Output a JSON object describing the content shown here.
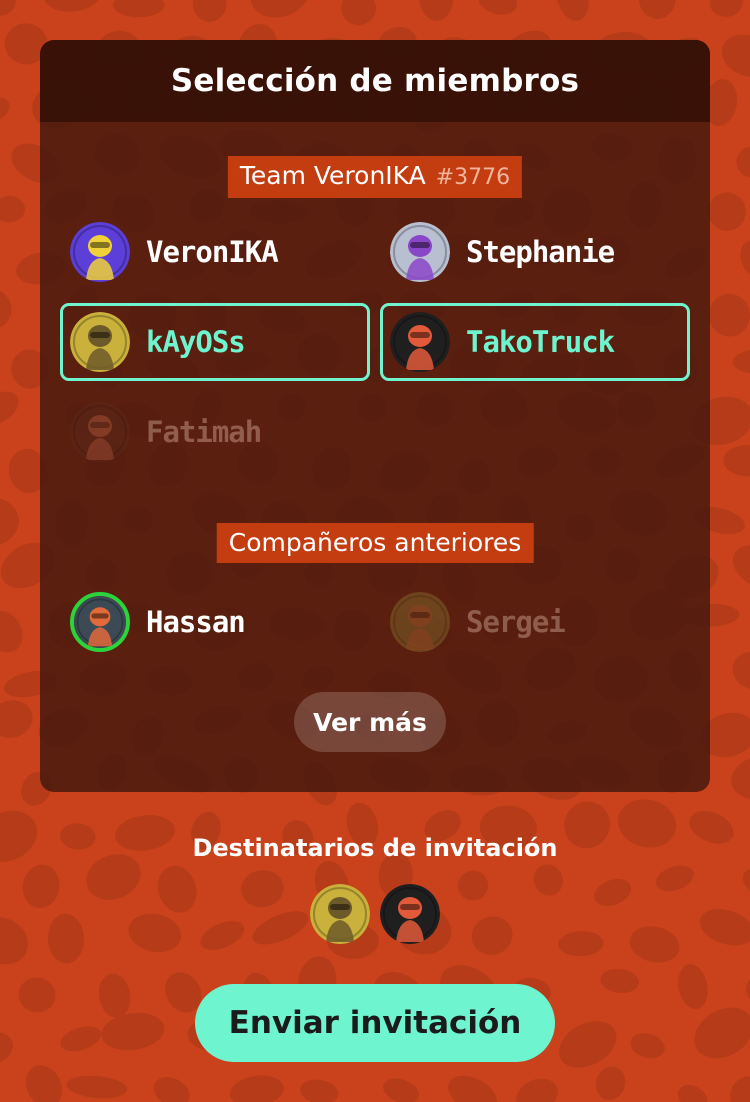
{
  "panel": {
    "title": "Selección de miembros"
  },
  "team": {
    "name": "Team VeronIKA",
    "tag": "#3776",
    "members": [
      {
        "name": "VeronIKA",
        "state": "normal",
        "avatar_bg": "#5b3fd8",
        "avatar_fg": "#f1d13a"
      },
      {
        "name": "Stephanie",
        "state": "normal",
        "avatar_bg": "#b8bfd0",
        "avatar_fg": "#8a46c8"
      },
      {
        "name": "kAyOSs",
        "state": "selected",
        "avatar_bg": "#c9b13b",
        "avatar_fg": "#6d5a2a"
      },
      {
        "name": "TakoTruck",
        "state": "selected",
        "avatar_bg": "#1f1f1f",
        "avatar_fg": "#e25a3a"
      },
      {
        "name": "Fatimah",
        "state": "unavailable",
        "avatar_bg": "#5a2b1e",
        "avatar_fg": "#c56a4c"
      }
    ]
  },
  "previous": {
    "label": "Compañeros anteriores",
    "members": [
      {
        "name": "Hassan",
        "state": "online",
        "avatar_bg": "#3c4a56",
        "avatar_fg": "#e06a3a"
      },
      {
        "name": "Sergei",
        "state": "unavailable",
        "avatar_bg": "#8e8036",
        "avatar_fg": "#c07a3a"
      }
    ]
  },
  "more_button": "Ver más",
  "recipients": {
    "title": "Destinatarios de invitación",
    "avatars": [
      {
        "avatar_bg": "#c9b13b",
        "avatar_fg": "#6d5a2a"
      },
      {
        "avatar_bg": "#1f1f1f",
        "avatar_fg": "#e25a3a"
      }
    ]
  },
  "send_button": "Enviar invitación",
  "colors": {
    "background": "#c9421c",
    "accent": "#6ef5cf",
    "label_bg": "#c33d11",
    "online_ring": "#2bd43a"
  }
}
